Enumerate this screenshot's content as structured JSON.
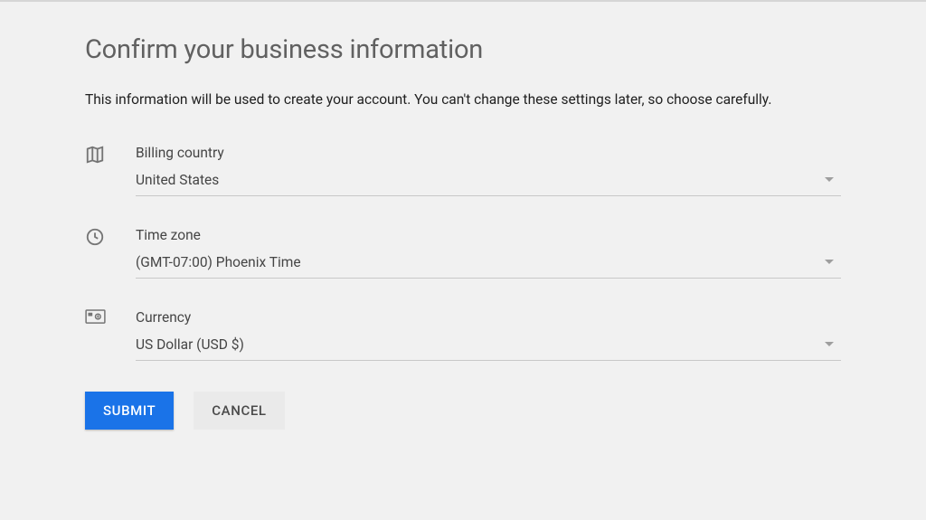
{
  "header": {
    "title": "Confirm your business information",
    "subtitle": "This information will be used to create your account. You can't change these settings later, so choose carefully."
  },
  "fields": {
    "billing_country": {
      "label": "Billing country",
      "value": "United States"
    },
    "time_zone": {
      "label": "Time zone",
      "value": "(GMT-07:00) Phoenix Time"
    },
    "currency": {
      "label": "Currency",
      "value": "US Dollar (USD $)"
    }
  },
  "buttons": {
    "submit": "Submit",
    "cancel": "Cancel"
  }
}
